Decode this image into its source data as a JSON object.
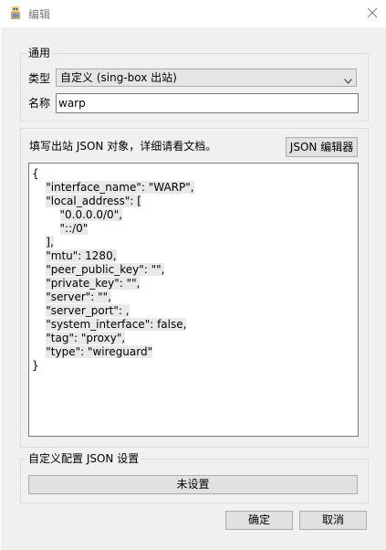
{
  "window": {
    "title": "编辑",
    "close_icon": "close-icon",
    "app_icon": "app-icon"
  },
  "general": {
    "group_title": "通用",
    "type_label": "类型",
    "type_value": "自定义 (sing-box 出站)",
    "name_label": "名称",
    "name_value": "warp"
  },
  "json": {
    "instruction": "填写出站 JSON 对象，详细请看文档。",
    "editor_button": "JSON 编辑器",
    "lines": [
      "{",
      "    \"interface_name\": \"WARP\",",
      "    \"local_address\": [",
      "        \"0.0.0.0/0\",",
      "        \"::/0\"",
      "    ],",
      "    \"mtu\": 1280,",
      "    \"peer_public_key\": \"\",",
      "    \"private_key\": \"\",",
      "    \"server\": \"\",",
      "    \"server_port\": ,",
      "    \"system_interface\": false,",
      "    \"tag\": \"proxy\",",
      "    \"type\": \"wireguard\"",
      "}"
    ]
  },
  "custom_config": {
    "group_title": "自定义配置 JSON 设置",
    "button": "未设置"
  },
  "footer": {
    "ok": "确定",
    "cancel": "取消"
  },
  "colors": {
    "background": "#f0f0f0",
    "button": "#e1e1e1",
    "border": "#adadad"
  }
}
